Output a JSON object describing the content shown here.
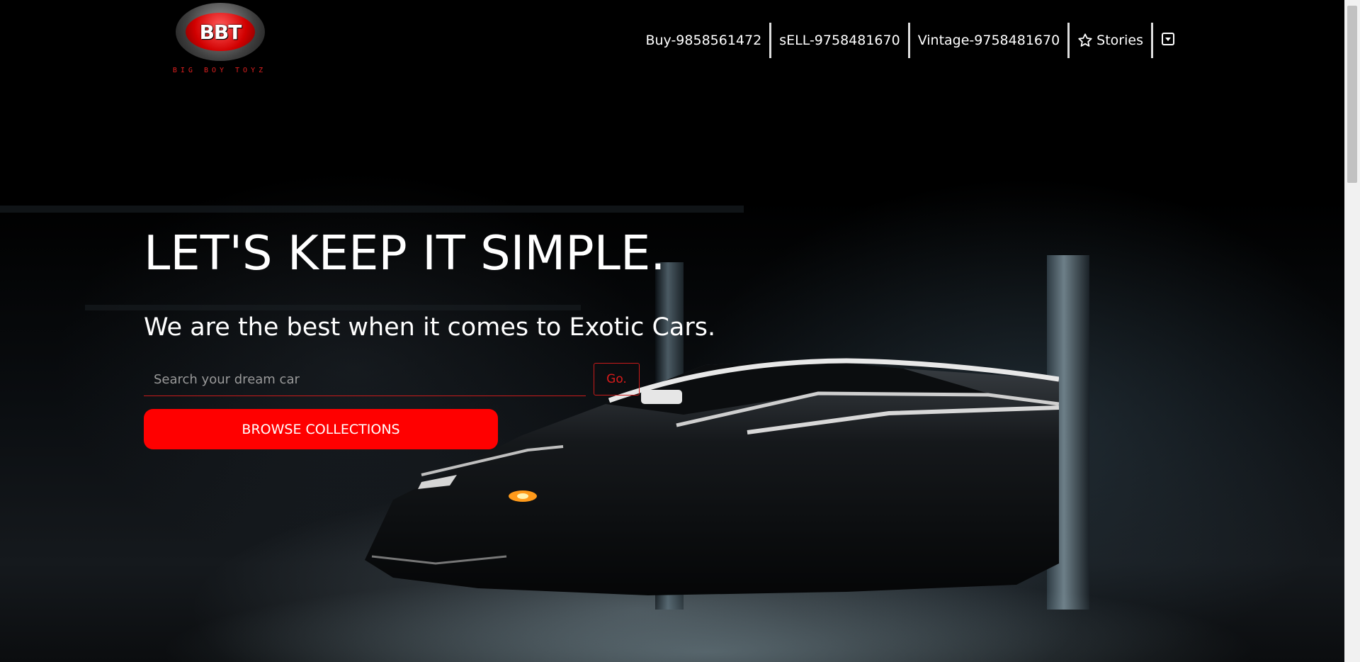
{
  "brand": {
    "logo_text": "BBT",
    "tagline": "BIG BOY TOYZ"
  },
  "nav": {
    "items": [
      {
        "label": "Buy-9858561472"
      },
      {
        "label": "sELL-9758481670"
      },
      {
        "label": "Vintage-9758481670"
      },
      {
        "label": "Stories",
        "icon": "star-outline-icon"
      }
    ],
    "menu_icon": "caret-square-down-icon"
  },
  "hero": {
    "headline": "LET'S KEEP IT SIMPLE.",
    "subline": "We are the best when it comes to Exotic Cars.",
    "search": {
      "placeholder": "Search your dream car",
      "value": "",
      "button_label": "Go."
    },
    "browse_label": "BROWSE COLLECTIONS"
  },
  "colors": {
    "accent": "#ff0000",
    "accent_border": "#c81b1b",
    "background": "#000000",
    "text": "#ffffff"
  }
}
